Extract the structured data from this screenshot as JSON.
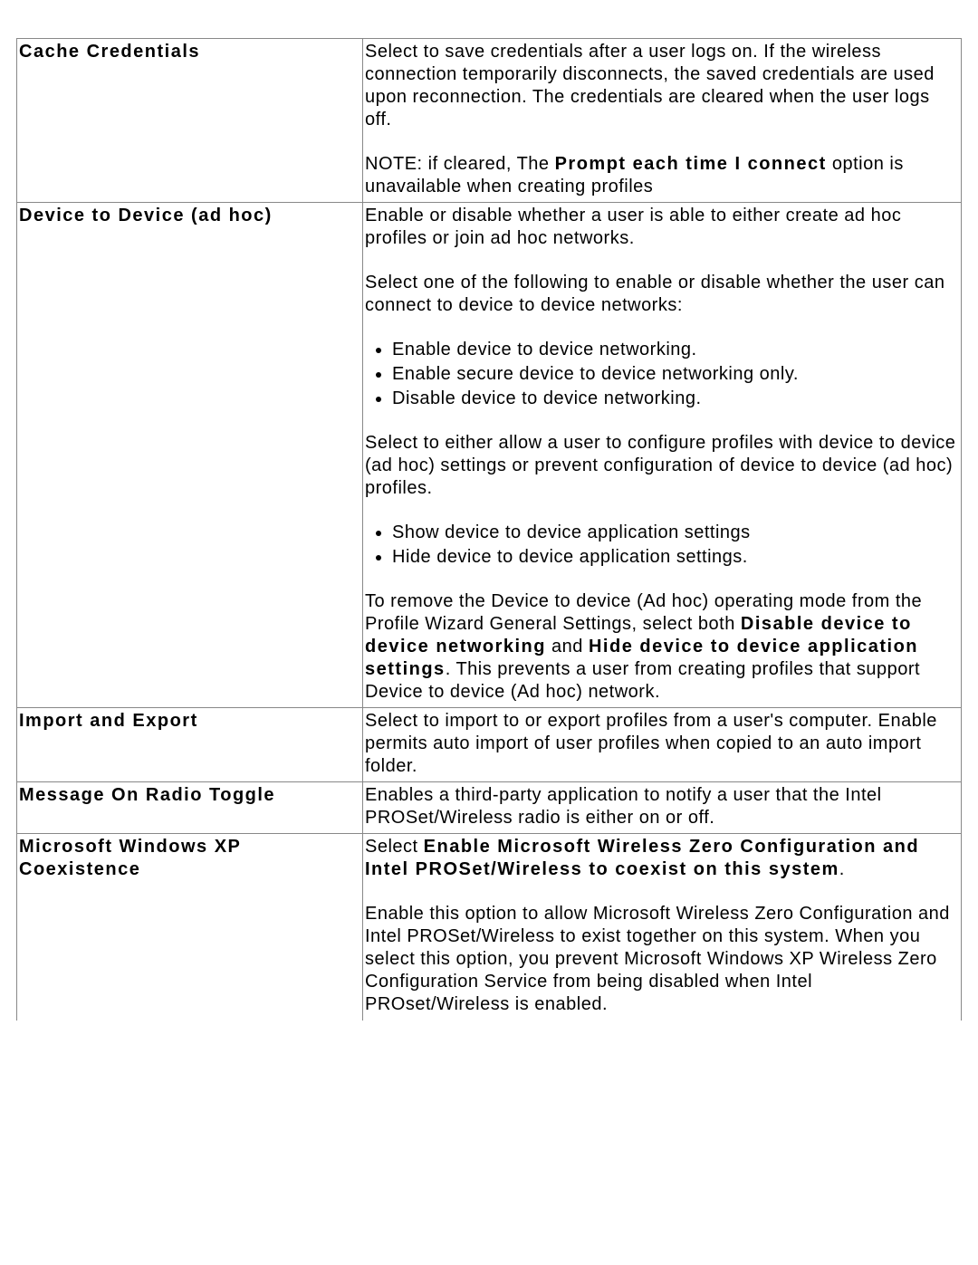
{
  "rows": [
    {
      "name": "Cache Credentials",
      "desc": {
        "p1": "Select to save credentials after a user logs on. If the wireless connection temporarily disconnects, the saved credentials are used upon reconnection. The credentials are cleared when the user logs off.",
        "note_prefix": "NOTE: if cleared, The ",
        "note_bold": "Prompt each time I connect",
        "note_suffix": " option is unavailable when creating profiles"
      }
    },
    {
      "name": "Device to Device (ad hoc)",
      "desc": {
        "p1": "Enable or disable whether a user is able to either create ad hoc profiles or join ad hoc networks.",
        "p2": "Select one of the following to enable or disable whether the user can connect to device to device networks:",
        "list1": [
          "Enable device to device networking.",
          "Enable secure device to device networking only.",
          "Disable device to device networking."
        ],
        "p3": "Select to either allow a user to configure profiles with device to device (ad hoc) settings or prevent configuration of device to device (ad hoc) profiles.",
        "list2": [
          "Show device to device application settings",
          "Hide device to device application settings."
        ],
        "p4_a": "To remove the Device to device (Ad hoc) operating mode from the Profile Wizard General Settings, select both ",
        "p4_b1": "Disable device to device networking",
        "p4_mid": " and ",
        "p4_b2": "Hide device to device application settings",
        "p4_c": ". This prevents a user from creating profiles that support Device to device (Ad hoc) network."
      }
    },
    {
      "name": "Import and Export",
      "desc": {
        "p1": "Select to import to or export profiles from a user's computer. Enable permits auto import of user profiles when copied to an auto import folder."
      }
    },
    {
      "name": "Message On Radio Toggle",
      "desc": {
        "p1": "Enables a third-party application to notify a user that the Intel PROSet/Wireless radio is either on or off."
      }
    },
    {
      "name": "Microsoft Windows XP Coexistence",
      "desc": {
        "p1_a": "Select ",
        "p1_b": "Enable Microsoft Wireless Zero Configuration and Intel PROSet/Wireless to coexist on this system",
        "p1_c": ".",
        "p2": "Enable this option to allow Microsoft Wireless Zero Configuration and Intel PROSet/Wireless to exist together on this system. When you select this option, you prevent Microsoft Windows XP Wireless Zero Configuration Service from being disabled when Intel PROset/Wireless is enabled."
      }
    }
  ]
}
